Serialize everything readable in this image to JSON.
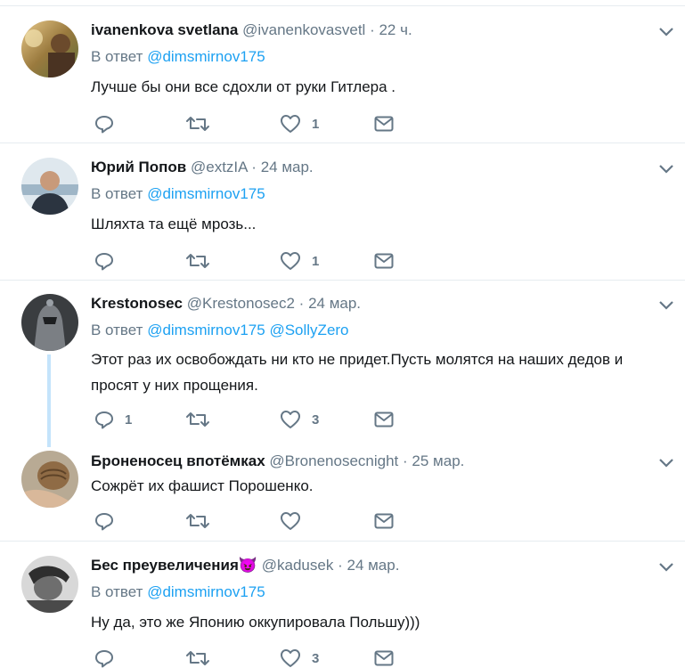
{
  "reply_prefix": "В ответ",
  "tweets": [
    {
      "name": "ivanenkova svetlana",
      "handle": "@ivanenkovasvetl",
      "dot": "·",
      "time": "22 ч.",
      "mentions": [
        "@dimsmirnov175"
      ],
      "text": "Лучше бы они все сдохли от руки Гитлера .",
      "reply_count": "",
      "retweet_count": "",
      "like_count": "1"
    },
    {
      "name": "Юрий Попов",
      "handle": "@extzIA",
      "dot": "·",
      "time": "24 мар.",
      "mentions": [
        "@dimsmirnov175"
      ],
      "text": "Шляхта та ещё мрозь...",
      "reply_count": "",
      "retweet_count": "",
      "like_count": "1"
    },
    {
      "name": "Krestonosec",
      "handle": "@Krestonosec2",
      "dot": "·",
      "time": "24 мар.",
      "mentions": [
        "@dimsmirnov175",
        "@SollyZero"
      ],
      "text": "Этот раз их освобождать ни кто не придет.Пусть молятся на наших дедов и просят у них прощения.",
      "reply_count": "1",
      "retweet_count": "",
      "like_count": "3"
    },
    {
      "name": "Броненосец впотёмках",
      "handle": "@Bronenosecnight",
      "dot": "·",
      "time": "25 мар.",
      "mentions": [],
      "text": "Сожрёт их фашист Порошенко.",
      "reply_count": "",
      "retweet_count": "",
      "like_count": ""
    },
    {
      "name": "Бес преувеличения",
      "emoji": "😈",
      "handle": "@kadusek",
      "dot": "·",
      "time": "24 мар.",
      "mentions": [
        "@dimsmirnov175"
      ],
      "text": "Ну да, это же Японию оккупировала Польшу)))",
      "reply_count": "",
      "retweet_count": "",
      "like_count": "3"
    }
  ],
  "icons": {
    "reply": "reply-icon",
    "retweet": "retweet-icon",
    "like": "like-icon",
    "dm": "direct-message-icon",
    "caret": "chevron-down-icon"
  },
  "colors": {
    "link": "#1da1f2",
    "muted": "#657786",
    "text": "#14171a",
    "thread_line": "#c4e4fb",
    "separator": "#e6ecf0"
  }
}
